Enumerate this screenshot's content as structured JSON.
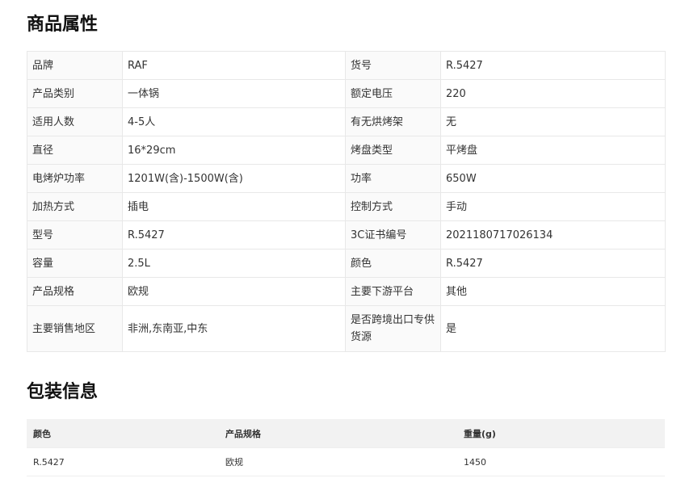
{
  "attributes_section": {
    "title": "商品属性",
    "rows": [
      [
        "品牌",
        "RAF",
        "货号",
        "R.5427"
      ],
      [
        "产品类别",
        "一体锅",
        "额定电压",
        "220"
      ],
      [
        "适用人数",
        "4-5人",
        "有无烘烤架",
        "无"
      ],
      [
        "直径",
        "16*29cm",
        "烤盘类型",
        "平烤盘"
      ],
      [
        "电烤炉功率",
        "1201W(含)-1500W(含)",
        "功率",
        "650W"
      ],
      [
        "加热方式",
        "插电",
        "控制方式",
        "手动"
      ],
      [
        "型号",
        "R.5427",
        "3C证书编号",
        "2021180717026134"
      ],
      [
        "容量",
        "2.5L",
        "颜色",
        "R.5427"
      ],
      [
        "产品规格",
        "欧规",
        "主要下游平台",
        "其他"
      ],
      [
        "主要销售地区",
        "非洲,东南亚,中东",
        "是否跨境出口专供货源",
        "是"
      ]
    ]
  },
  "packaging_section": {
    "title": "包装信息",
    "headers": [
      "颜色",
      "产品规格",
      "重量(g)"
    ],
    "rows": [
      [
        "R.5427",
        "欧规",
        "1450"
      ]
    ]
  }
}
